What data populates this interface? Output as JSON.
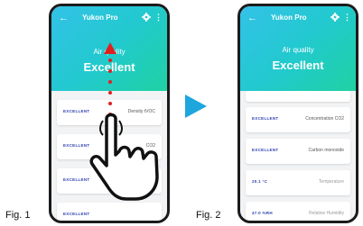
{
  "colors": {
    "header_start": "#33c2e8",
    "header_end": "#1fd2a3",
    "card_value": "#2c3fb0",
    "swipe_arrow": "#e02020",
    "play_arrow": "#1ea6dd"
  },
  "fig1": {
    "caption": "Fig. 1",
    "app_title": "Yukon Pro",
    "air_quality_label": "Air quality",
    "air_quality_value": "Excellent",
    "cards": [
      {
        "value": "EXCELLENT",
        "label": "Density tVOC"
      },
      {
        "value": "EXCELLENT",
        "label": "CO2"
      },
      {
        "value": "EXCELLENT",
        "label": ""
      },
      {
        "value": "EXCELLENT",
        "label": ""
      }
    ]
  },
  "fig2": {
    "caption": "Fig. 2",
    "app_title": "Yukon Pro",
    "air_quality_label": "Air quality",
    "air_quality_value": "Excellent",
    "cards": [
      {
        "value": "",
        "label": ""
      },
      {
        "value": "EXCELLENT",
        "label": "Concentration CO2"
      },
      {
        "value": "EXCELLENT",
        "label": "Carbon monoxide"
      },
      {
        "value": "20.1 °C",
        "label": "Temperature"
      },
      {
        "value": "47.0 %RH",
        "label": "Relative Humidity"
      }
    ]
  },
  "icons": {
    "back": "back-arrow-icon",
    "settings": "gear-icon",
    "menu": "more-vert-icon",
    "swipe": "hand-pointer-icon",
    "next": "play-arrow-icon"
  }
}
